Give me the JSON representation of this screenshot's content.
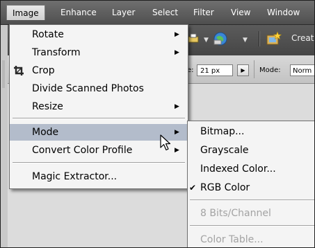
{
  "menubar": {
    "items": [
      "Image",
      "Enhance",
      "Layer",
      "Select",
      "Filter",
      "View",
      "Window"
    ],
    "active": "Image"
  },
  "toolbar": {
    "create_label": "Create",
    "size_label": "e:",
    "size_value": "21 px",
    "mode_label": "Mode:",
    "mode_value": "Norm"
  },
  "image_menu": {
    "items": [
      {
        "label": "Rotate",
        "submenu": true
      },
      {
        "label": "Transform",
        "submenu": true
      },
      {
        "label": "Crop",
        "icon": "crop-icon"
      },
      {
        "label": "Divide Scanned Photos"
      },
      {
        "label": "Resize",
        "submenu": true
      },
      {
        "label": "Mode",
        "submenu": true,
        "highlighted": true
      },
      {
        "label": "Convert Color Profile",
        "submenu": true
      },
      {
        "label": "Magic Extractor..."
      }
    ]
  },
  "mode_submenu": {
    "items": [
      {
        "label": "Bitmap...",
        "enabled": true
      },
      {
        "label": "Grayscale",
        "enabled": true
      },
      {
        "label": "Indexed Color...",
        "enabled": true
      },
      {
        "label": "RGB Color",
        "enabled": true,
        "checked": true
      },
      {
        "label": "8 Bits/Channel",
        "enabled": false
      },
      {
        "label": "Color Table...",
        "enabled": false
      }
    ],
    "check_glyph": "✔"
  },
  "colors": {
    "menubar_bg": "#5a5a5a",
    "menu_bg": "#f4f4f4",
    "highlight": "#b3bccb",
    "disabled_text": "#a3a3a3"
  }
}
